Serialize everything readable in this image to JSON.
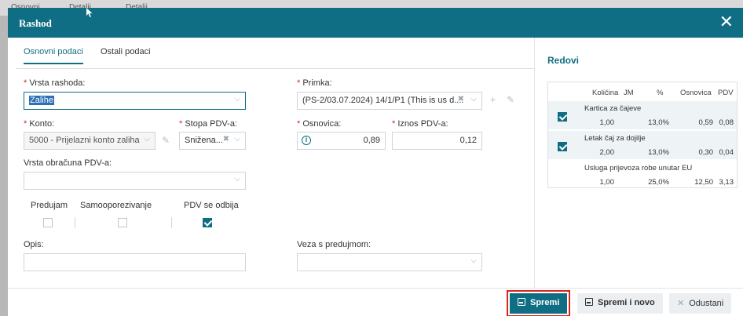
{
  "modal": {
    "title": "Rashod",
    "close_glyph": "✕"
  },
  "tabs": [
    {
      "label": "Osnovni podaci",
      "active": true
    },
    {
      "label": "Ostali podaci",
      "active": false
    }
  ],
  "form": {
    "vrsta_rashoda": {
      "label": "Vrsta rashoda:",
      "value": "Zalihe"
    },
    "primka": {
      "label": "Primka:",
      "value": "(PS-2/03.07.2024) 14/1/P1 (This is us d...."
    },
    "konto": {
      "label": "Konto:",
      "value": "5000 - Prijelazni konto zaliha"
    },
    "stopa_pdv": {
      "label": "Stopa PDV-a:",
      "value": "Snižena..."
    },
    "osnovica": {
      "label": "Osnovica:",
      "value": "0,89"
    },
    "iznos_pdv": {
      "label": "Iznos PDV-a:",
      "value": "0,12"
    },
    "vrsta_obracuna": {
      "label": "Vrsta obračuna PDV-a:",
      "value": ""
    },
    "checkboxes": [
      {
        "label": "Predujam",
        "checked": false
      },
      {
        "label": "Samooporezivanje",
        "checked": false
      },
      {
        "label": "PDV se odbija",
        "checked": true
      }
    ],
    "opis": {
      "label": "Opis:",
      "value": ""
    },
    "veza": {
      "label": "Veza s predujmom:",
      "value": ""
    }
  },
  "redovi": {
    "title": "Redovi",
    "columns": [
      "Količina",
      "JM",
      "%",
      "Osnovica",
      "PDV"
    ],
    "rows": [
      {
        "name": "Kartica za čajeve",
        "kolicina": "1,00",
        "pct": "13,0%",
        "osnovica": "0,59",
        "pdv": "0,08",
        "checked": true
      },
      {
        "name": "Letak čaj za dojilje",
        "kolicina": "2,00",
        "pct": "13,0%",
        "osnovica": "0,30",
        "pdv": "0,04",
        "checked": true
      },
      {
        "name": "Usluga prijevoza robe unutar EU",
        "kolicina": "1,00",
        "pct": "25,0%",
        "osnovica": "12,50",
        "pdv": "3,13",
        "checked": false
      }
    ]
  },
  "footer": {
    "save": "Spremi",
    "save_new": "Spremi i novo",
    "cancel": "Odustani"
  },
  "background": {
    "tab1": "Osnovni",
    "tab2": "Detalji",
    "tab3": "Detalji"
  }
}
